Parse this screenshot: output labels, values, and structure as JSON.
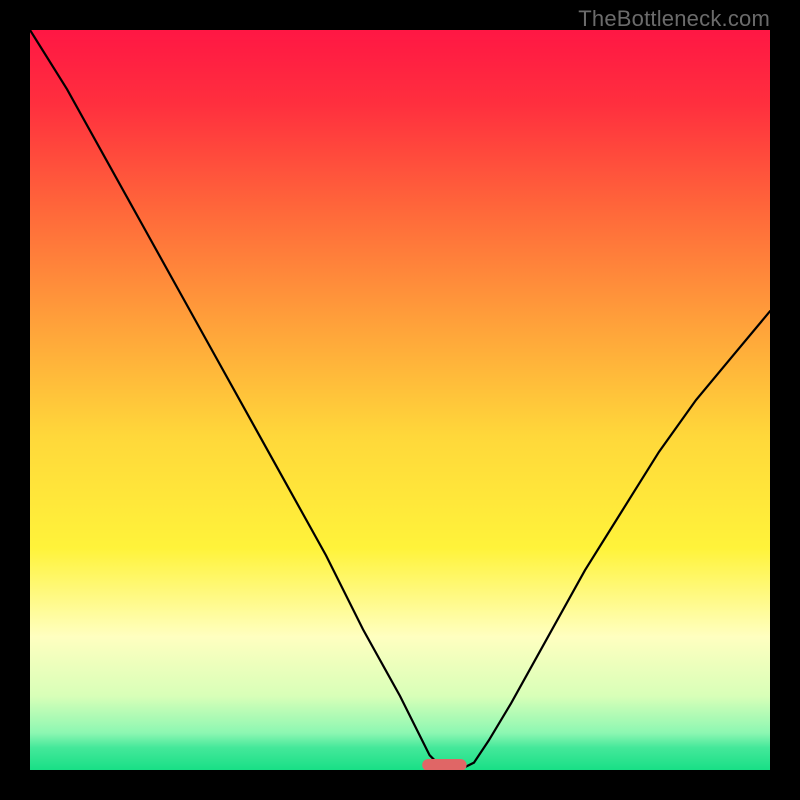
{
  "watermark": "TheBottleneck.com",
  "chart_data": {
    "type": "line",
    "title": "",
    "xlabel": "",
    "ylabel": "",
    "xlim": [
      0,
      100
    ],
    "ylim": [
      0,
      100
    ],
    "background_gradient_stops": [
      {
        "offset": 0.0,
        "color": "#ff1744"
      },
      {
        "offset": 0.1,
        "color": "#ff2f3e"
      },
      {
        "offset": 0.25,
        "color": "#ff6a3a"
      },
      {
        "offset": 0.4,
        "color": "#ffa23a"
      },
      {
        "offset": 0.55,
        "color": "#ffd83a"
      },
      {
        "offset": 0.7,
        "color": "#fff33a"
      },
      {
        "offset": 0.82,
        "color": "#ffffc0"
      },
      {
        "offset": 0.9,
        "color": "#d8ffb8"
      },
      {
        "offset": 0.95,
        "color": "#8cf7b2"
      },
      {
        "offset": 0.97,
        "color": "#44e89a"
      },
      {
        "offset": 1.0,
        "color": "#18df86"
      }
    ],
    "series": [
      {
        "name": "bottleneck-curve",
        "x": [
          0,
          5,
          10,
          15,
          20,
          25,
          30,
          35,
          40,
          45,
          50,
          52,
          54,
          56,
          58,
          60,
          62,
          65,
          70,
          75,
          80,
          85,
          90,
          95,
          100
        ],
        "values": [
          100,
          92,
          83,
          74,
          65,
          56,
          47,
          38,
          29,
          19,
          10,
          6,
          2,
          0,
          0,
          1,
          4,
          9,
          18,
          27,
          35,
          43,
          50,
          56,
          62
        ]
      }
    ],
    "marker": {
      "name": "optimal-point",
      "x_center": 56,
      "x_halfwidth": 3,
      "color": "#e06666"
    }
  }
}
